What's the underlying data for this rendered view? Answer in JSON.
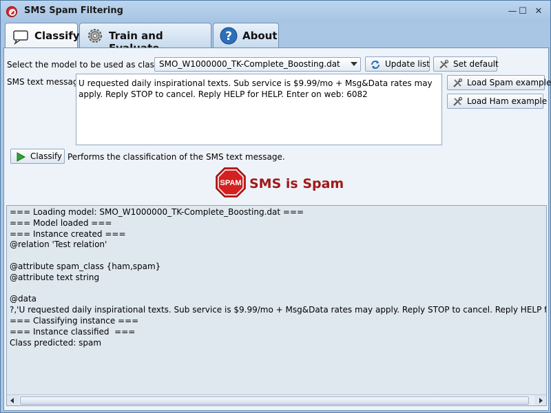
{
  "window": {
    "title": "SMS Spam Filtering",
    "minimize_glyph": "—",
    "maximize_glyph": "☐",
    "close_glyph": "✕"
  },
  "tabs": [
    {
      "label": "Classify",
      "icon": "speech-bubble-icon",
      "active": true
    },
    {
      "label": "Train and Evaluate",
      "icon": "gear-icon",
      "active": false
    },
    {
      "label": "About",
      "icon": "help-icon",
      "active": false
    }
  ],
  "classify": {
    "model_label": "Select the model to be used as classifier",
    "model_selected": "SMO_W1000000_TK-Complete_Boosting.dat",
    "update_list_label": "Update list",
    "set_default_label": "Set default",
    "sms_label": "SMS text message",
    "sms_text": "U requested daily inspirational texts. Sub service is $9.99/mo + Msg&Data rates may apply. Reply STOP to cancel. Reply HELP for HELP. Enter on web: 6082",
    "load_spam_label": "Load Spam example",
    "load_ham_label": "Load Ham example",
    "classify_button_label": "Classify",
    "classify_desc": "Performs the classification of the SMS text message.",
    "result_icon_text": "SPAM",
    "result_text": "SMS is Spam",
    "result_color": "#a01818"
  },
  "log": {
    "lines": [
      "=== Loading model: SMO_W1000000_TK-Complete_Boosting.dat ===",
      "=== Model loaded ===",
      "=== Instance created ===",
      "@relation 'Test relation'",
      "",
      "@attribute spam_class {ham,spam}",
      "@attribute text string",
      "",
      "@data",
      "?,'U requested daily inspirational texts. Sub service is $9.99/mo + Msg&Data rates may apply. Reply STOP to cancel. Reply HELP for HELP. Enter on w",
      "=== Classifying instance ===",
      "=== Instance classified  ===",
      "Class predicted: spam"
    ]
  }
}
